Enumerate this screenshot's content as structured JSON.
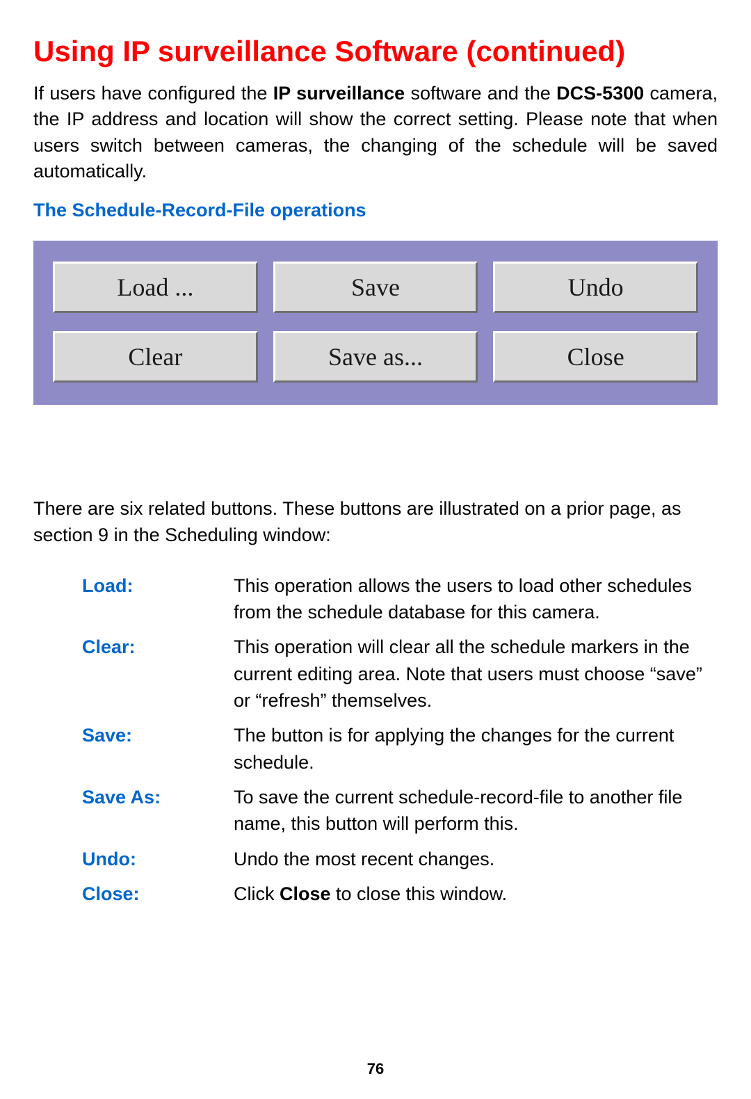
{
  "title": "Using IP surveillance Software (continued)",
  "intro_parts": {
    "p1": "If users have configured the ",
    "b1": "IP surveillance",
    "p2": " software  and the ",
    "b2": "DCS-5300",
    "p3": " camera, the IP address and location will show the correct setting. Please note that when users switch between cameras, the changing of the schedule will be saved automatically."
  },
  "subtitle": "The Schedule-Record-File operations",
  "buttons": {
    "row1": {
      "b1": "Load ...",
      "b2": "Save",
      "b3": "Undo"
    },
    "row2": {
      "b1": "Clear",
      "b2": "Save as...",
      "b3": "Close"
    }
  },
  "explain": "There are six related buttons. These buttons are illustrated on a prior page, as section 9 in the Scheduling window:",
  "defs": {
    "load": {
      "term": "Load:",
      "desc": "This operation allows the users to load other schedules from the schedule database for this camera."
    },
    "clear": {
      "term": "Clear:",
      "desc": "This operation will clear all the schedule markers in the current editing area. Note that users must choose “save” or “refresh” themselves."
    },
    "save": {
      "term": "Save:",
      "desc": "The button is for applying the changes for the current schedule."
    },
    "saveas": {
      "term": "Save As:",
      "desc": "To save the current schedule-record-file to another file name, this button will perform this."
    },
    "undo": {
      "term": "Undo:",
      "desc": "Undo the most recent changes."
    },
    "close": {
      "term": "Close:",
      "desc_pre": "Click ",
      "desc_bold": "Close",
      "desc_post": " to close this window."
    }
  },
  "page_number": "76"
}
